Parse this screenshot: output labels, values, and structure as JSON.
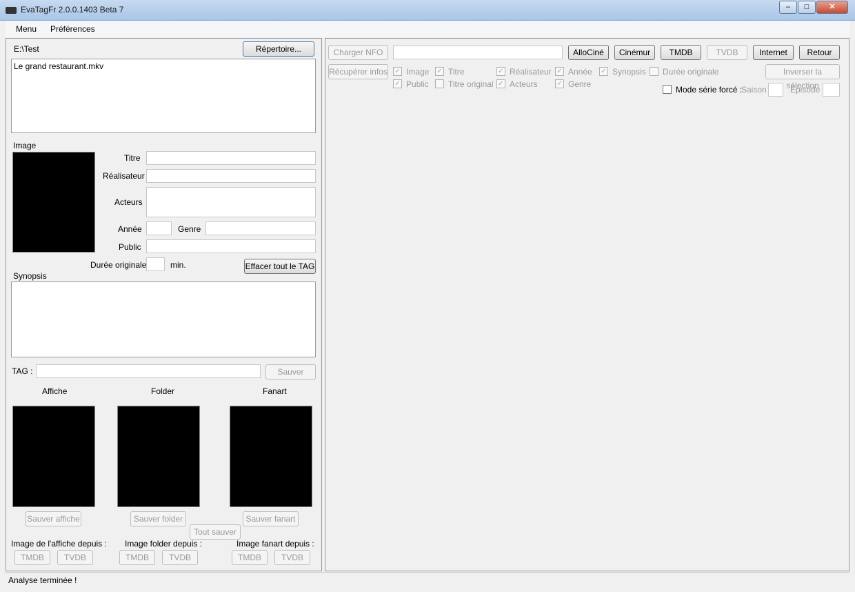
{
  "window": {
    "title": "EvaTagFr 2.0.0.1403 Beta 7",
    "minimize": "–",
    "maximize": "□",
    "close": "✕"
  },
  "menu": [
    "Menu",
    "Préférences"
  ],
  "left": {
    "path": "E:\\Test",
    "repertoire": "Répertoire...",
    "files": [
      "Le grand restaurant.mkv"
    ],
    "image_label": "Image",
    "titre": "Titre",
    "realisateur": "Réalisateur",
    "acteurs": "Acteurs",
    "annee": "Année",
    "genre": "Genre",
    "public": "Public",
    "duree": "Durée originale",
    "min": "min.",
    "effacer": "Effacer tout le TAG",
    "synopsis": "Synopsis",
    "tag": "TAG :",
    "sauver": "Sauver",
    "affiche": "Affiche",
    "folder": "Folder",
    "fanart": "Fanart",
    "sauver_affiche": "Sauver affiche",
    "sauver_folder": "Sauver folder",
    "sauver_fanart": "Sauver fanart",
    "tout_sauver": "Tout sauver",
    "img_affiche": "Image de l'affiche depuis :",
    "img_folder": "Image folder depuis :",
    "img_fanart": "Image fanart depuis :",
    "tmdb": "TMDB",
    "tvdb": "TVDB"
  },
  "right": {
    "charger_nfo": "Charger NFO",
    "nfo_value": "",
    "buttons": [
      "AlloCiné",
      "Cinémur",
      "TMDB",
      "TVDB",
      "Internet",
      "Retour"
    ],
    "recuperer": "Récupérer infos",
    "checks": [
      {
        "label": "Image",
        "checked": true
      },
      {
        "label": "Titre",
        "checked": true
      },
      {
        "label": "Réalisateur",
        "checked": true
      },
      {
        "label": "Année",
        "checked": true
      },
      {
        "label": "Synopsis",
        "checked": true
      },
      {
        "label": "Durée originale",
        "checked": false
      },
      {
        "label": "Public",
        "checked": true
      },
      {
        "label": "Titre original",
        "checked": false
      },
      {
        "label": "Acteurs",
        "checked": true
      },
      {
        "label": "Genre",
        "checked": true
      }
    ],
    "inverser": "Inverser la sélection",
    "mode_serie": "Mode série forcé :",
    "mode_serie_checked": false,
    "saison": "Saison",
    "episode": "Épisode"
  },
  "status": "Analyse terminée !"
}
